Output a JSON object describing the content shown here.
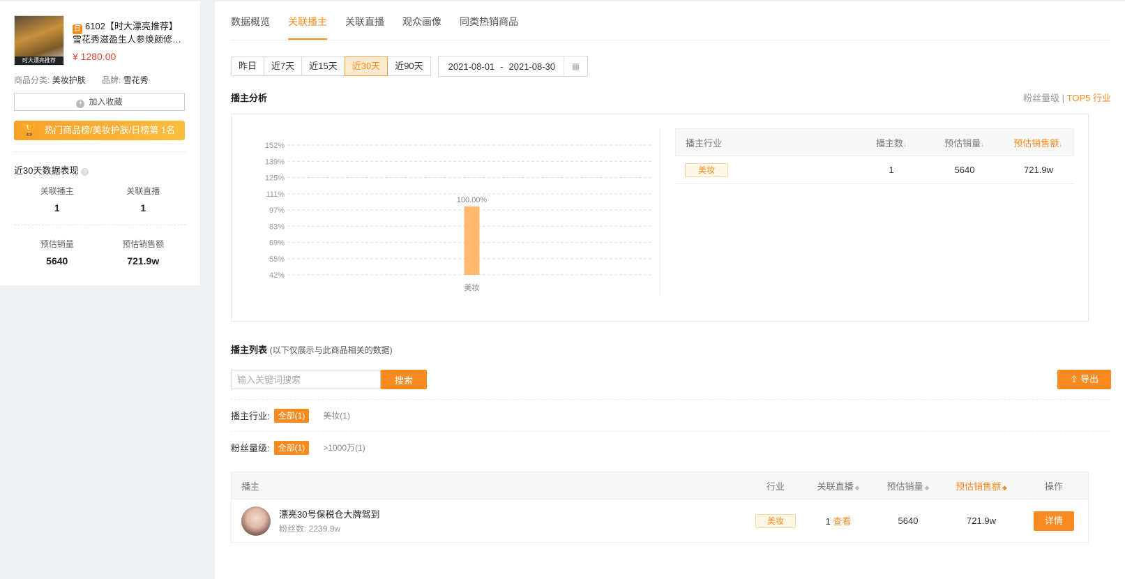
{
  "product": {
    "badge": "日",
    "title_line1": "6102【时大漂亮推荐】",
    "title_line2": "雪花秀滋盈生人参焕颜修护...",
    "image_caption": "时大漂亮推荐",
    "price": "¥ 1280.00",
    "category_label": "商品分类:",
    "category_value": "美妆护肤",
    "brand_label": "品牌:",
    "brand_value": "雪花秀",
    "fav_label": "加入收藏",
    "rank_text": "热门商品榜/美妆护肤/日榜第 1名"
  },
  "perf": {
    "title": "近30天数据表现",
    "items": [
      {
        "label": "关联播主",
        "value": "1"
      },
      {
        "label": "关联直播",
        "value": "1"
      },
      {
        "label": "预估销量",
        "value": "5640"
      },
      {
        "label": "预估销售额",
        "value": "721.9w"
      }
    ]
  },
  "tabs": [
    "数据概览",
    "关联播主",
    "关联直播",
    "观众画像",
    "同类热销商品"
  ],
  "ranges": [
    "昨日",
    "近7天",
    "近15天",
    "近30天",
    "近90天"
  ],
  "date": {
    "start": "2021-08-01",
    "sep": "-",
    "end": "2021-08-30"
  },
  "analysis": {
    "title": "播主分析",
    "switch_a": "粉丝量级",
    "switch_sep": " | ",
    "switch_b": "TOP5 行业"
  },
  "chart_data": {
    "type": "bar",
    "categories": [
      "美妆"
    ],
    "values": [
      100
    ],
    "data_labels": [
      "100.00%"
    ],
    "yticks": [
      "42%",
      "55%",
      "69%",
      "83%",
      "97%",
      "111%",
      "125%",
      "139%",
      "152%"
    ],
    "ylim": [
      42,
      152
    ],
    "grid": true,
    "bar_color": "#ffb86c"
  },
  "industry_table": {
    "headers": [
      "播主行业",
      "播主数",
      "预估销量",
      "预估销售额"
    ],
    "rows": [
      {
        "industry": "美妆",
        "count": "1",
        "sales": "5640",
        "amount": "721.9w"
      }
    ]
  },
  "list": {
    "title": "播主列表",
    "note": "(以下仅展示与此商品相关的数据)",
    "search_placeholder": "输入关键词搜索",
    "search_btn": "搜索",
    "export_btn": "导出",
    "filter_industry_label": "播主行业:",
    "filter_industry": [
      "全部(1)",
      "美妆(1)"
    ],
    "filter_fans_label": "粉丝量级:",
    "filter_fans": [
      "全部(1)",
      ">1000万(1)"
    ],
    "headers": [
      "播主",
      "行业",
      "关联直播",
      "预估销量",
      "预估销售额",
      "操作"
    ],
    "rows": [
      {
        "name": "漂亮30号保税仓大牌驾到",
        "fans": "粉丝数: 2239.9w",
        "industry": "美妆",
        "live_count": "1",
        "live_link": "查看",
        "sales": "5640",
        "amount": "721.9w",
        "action": "详情"
      }
    ]
  }
}
